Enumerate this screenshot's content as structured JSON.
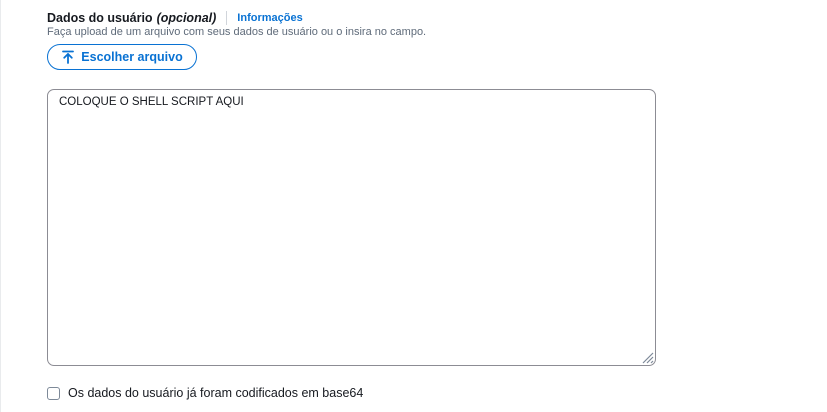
{
  "field": {
    "label": "Dados do usuário",
    "optional": "(opcional)",
    "info_link": "Informações",
    "description": "Faça upload de um arquivo com seus dados de usuário ou o insira no campo."
  },
  "upload": {
    "label": "Escolher arquivo",
    "icon": "upload-icon"
  },
  "textarea": {
    "value": "COLOQUE O SHELL SCRIPT AQUI"
  },
  "checkbox": {
    "label": "Os dados do usuário já foram codificados em base64",
    "checked": false
  },
  "colors": {
    "link": "#0972d3",
    "text": "#16191f",
    "muted": "#5f6b7a",
    "border": "#8c8c94"
  }
}
